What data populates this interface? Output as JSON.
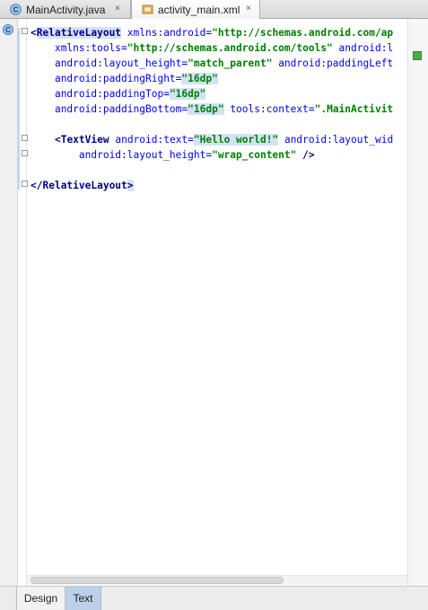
{
  "tabs": [
    {
      "label": "MainActivity.java",
      "icon": "class-c-icon",
      "close": "×"
    },
    {
      "label": "activity_main.xml",
      "icon": "xml-layout-icon",
      "close": "×",
      "active": true
    }
  ],
  "gutter": {
    "class_icon_letter": "C"
  },
  "code": {
    "l1": {
      "open": "<",
      "tag": "RelativeLayout",
      "a1": "xmlns:android=",
      "v1": "\"http://schemas.android.com/ap"
    },
    "l2": {
      "a1": "xmlns:tools=",
      "v1": "\"http://schemas.android.com/tools\"",
      "a2": "android:l"
    },
    "l3": {
      "a1": "android:layout_height=",
      "v1": "\"match_parent\"",
      "a2": "android:paddingLeft"
    },
    "l4": {
      "a1": "android:paddingRight=",
      "v1": "\"16dp\""
    },
    "l5": {
      "a1": "android:paddingTop=",
      "v1": "\"16dp\""
    },
    "l6": {
      "a1": "android:paddingBottom=",
      "v1": "\"16dp\"",
      "a2": "tools:context=",
      "v2": "\".MainActivit"
    },
    "l8": {
      "open": "<",
      "tag": "TextView",
      "a1": "android:text=",
      "v1": "\"Hello world!\"",
      "a2": "android:layout_wid"
    },
    "l9": {
      "a1": "android:layout_height=",
      "v1": "\"wrap_content\"",
      "close": " />"
    },
    "l11": {
      "open": "</",
      "tag": "RelativeLayout",
      "close": ">"
    }
  },
  "bottom_tabs": {
    "design": "Design",
    "text": "Text",
    "active": "Text"
  },
  "colors": {
    "tag": "#000080",
    "attribute": "#0000ff",
    "value": "#008000",
    "active_tab": "#bcd0ea"
  }
}
